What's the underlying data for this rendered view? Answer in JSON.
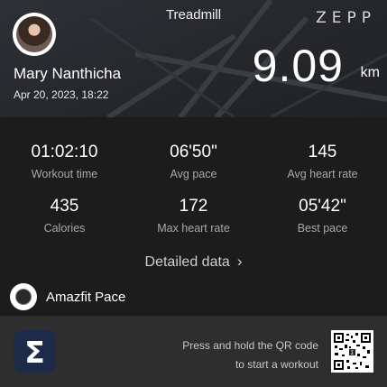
{
  "header": {
    "activity": "Treadmill",
    "brand": "ZEPP",
    "user_name": "Mary Nanthicha",
    "datetime": "Apr 20, 2023, 18:22",
    "distance": "9.09",
    "distance_unit": "km"
  },
  "stats": [
    {
      "value": "01:02:10",
      "label": "Workout time"
    },
    {
      "value": "06'50\"",
      "label": "Avg pace"
    },
    {
      "value": "145",
      "label": "Avg heart rate"
    },
    {
      "value": "435",
      "label": "Calories"
    },
    {
      "value": "172",
      "label": "Max heart rate"
    },
    {
      "value": "05'42\"",
      "label": "Best pace"
    }
  ],
  "detail_link": "Detailed data",
  "device": {
    "name": "Amazfit Pace"
  },
  "footer": {
    "app_logo_glyph": "Σ",
    "qr_line1": "Press and hold the QR code",
    "qr_line2": "to start a workout"
  },
  "icons": [
    "avatar",
    "chevron-right-icon",
    "watch-icon",
    "zepp-app-icon",
    "qr-code"
  ]
}
